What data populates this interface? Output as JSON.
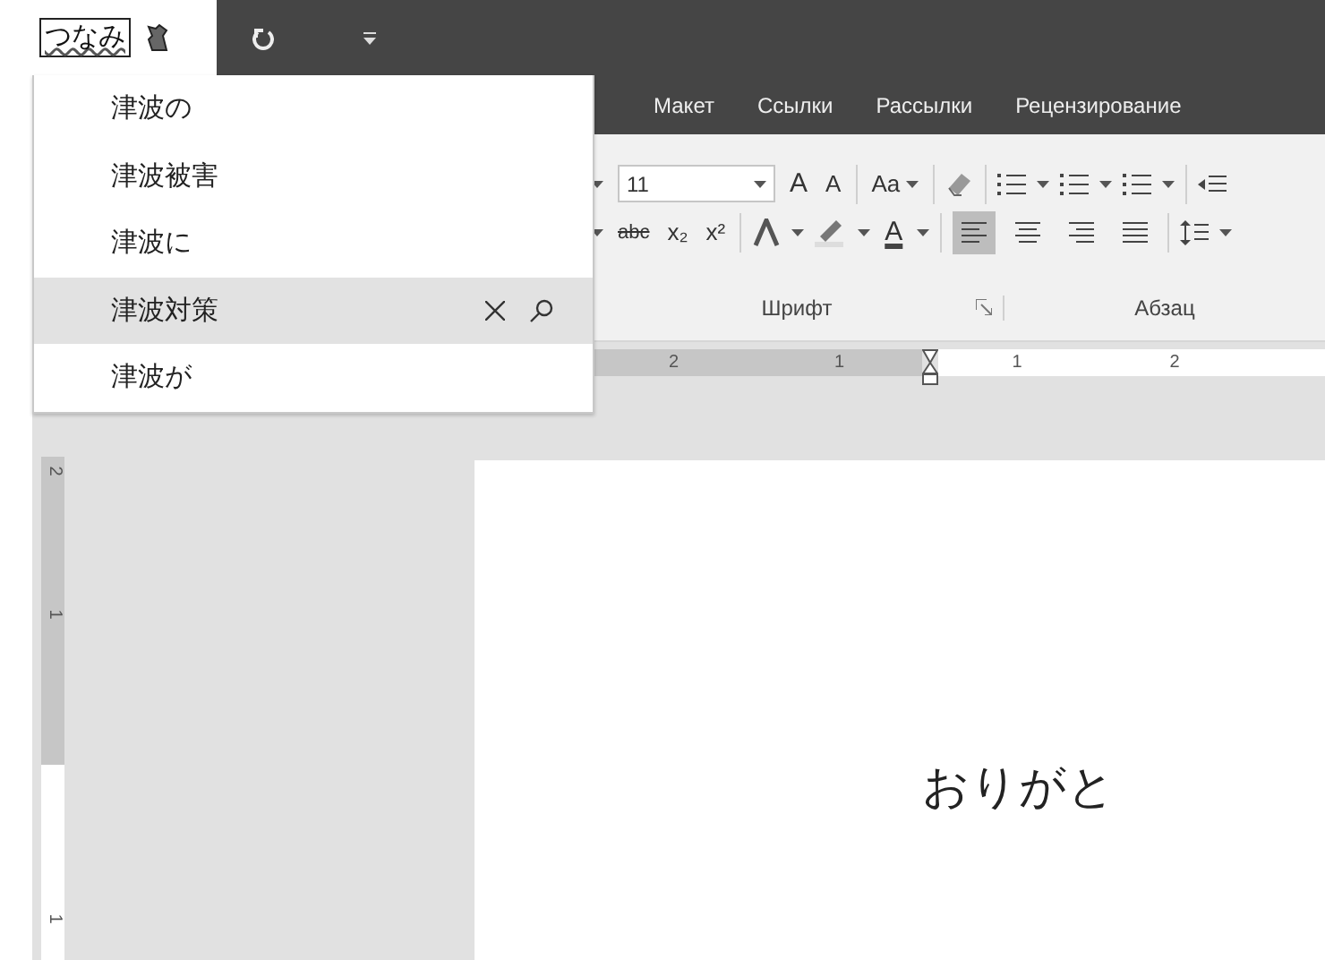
{
  "ime": {
    "composition": "つなみ"
  },
  "suggestions": [
    {
      "text": "津波の",
      "selected": false
    },
    {
      "text": "津波被害",
      "selected": false
    },
    {
      "text": "津波に",
      "selected": false
    },
    {
      "text": "津波対策",
      "selected": true
    },
    {
      "text": "津波が",
      "selected": false
    }
  ],
  "tabs": [
    {
      "label": "Макет"
    },
    {
      "label": "Ссылки"
    },
    {
      "label": "Рассылки"
    },
    {
      "label": "Рецензирование"
    }
  ],
  "ribbon": {
    "font_size": "11",
    "grow_font": "A",
    "shrink_font": "A",
    "change_case": "Aa",
    "strikethrough": "abc",
    "subscript": "x₂",
    "superscript": "x²",
    "font_color": "A",
    "groups": [
      "Шрифт",
      "Абзац"
    ]
  },
  "ruler": {
    "labels": [
      "2",
      "1",
      "1",
      "2"
    ]
  },
  "vertical_ruler": {
    "labels": [
      "2",
      "1",
      "1"
    ]
  },
  "document": {
    "text": "おりがと"
  }
}
